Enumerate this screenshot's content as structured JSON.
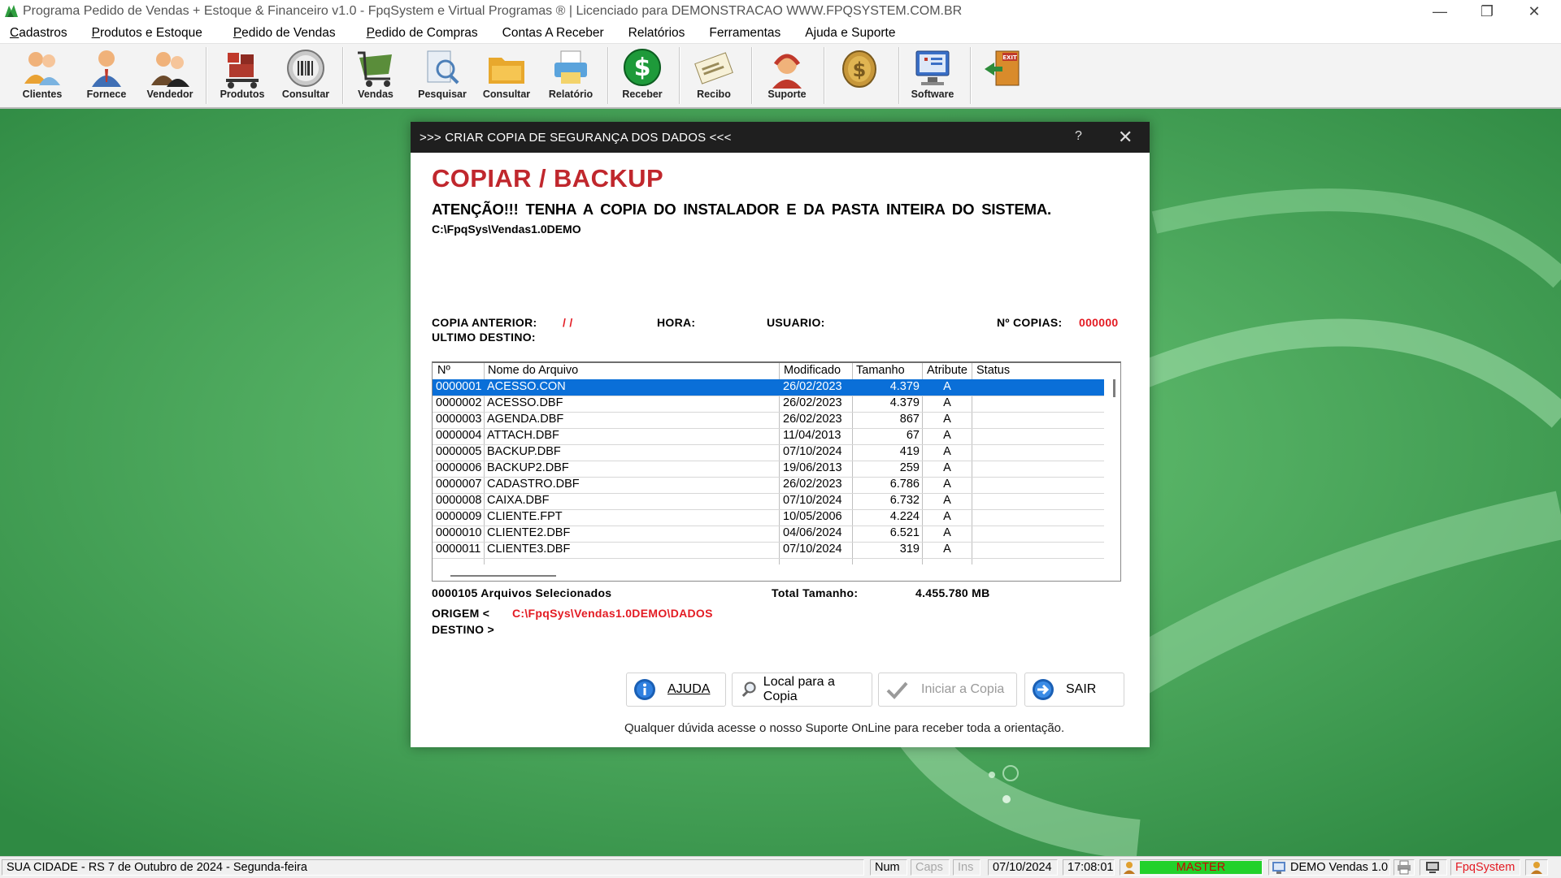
{
  "window": {
    "title": "Programa Pedido de Vendas + Estoque & Financeiro v1.0 - FpqSystem e Virtual Programas ® | Licenciado para  DEMONSTRACAO WWW.FPQSYSTEM.COM.BR"
  },
  "menu": [
    {
      "first": "C",
      "rest": "adastros"
    },
    {
      "first": "P",
      "rest": "rodutos e Estoque"
    },
    {
      "first": "P",
      "rest": "edido de Vendas"
    },
    {
      "first": "P",
      "rest": "edido de Compras"
    },
    {
      "first": "",
      "rest": "Contas A Receber"
    },
    {
      "first": "",
      "rest": "Relatórios"
    },
    {
      "first": "",
      "rest": "Ferramentas"
    },
    {
      "first": "",
      "rest": "Ajuda e Suporte"
    }
  ],
  "toolbar": [
    {
      "label": "Clientes",
      "icon": "clients-icon"
    },
    {
      "label": "Fornece",
      "icon": "supplier-icon"
    },
    {
      "label": "Vendedor",
      "icon": "seller-icon"
    },
    {
      "label": "Produtos",
      "icon": "products-icon"
    },
    {
      "label": "Consultar",
      "icon": "barcode-icon"
    },
    {
      "label": "Vendas",
      "icon": "cart-icon"
    },
    {
      "label": "Pesquisar",
      "icon": "search-doc-icon"
    },
    {
      "label": "Consultar",
      "icon": "folder-icon"
    },
    {
      "label": "Relatório",
      "icon": "printer-icon"
    },
    {
      "label": "Receber",
      "icon": "dollar-icon"
    },
    {
      "label": "Recibo",
      "icon": "receipt-icon"
    },
    {
      "label": "Suporte",
      "icon": "support-icon"
    },
    {
      "label": "",
      "icon": "coin-icon"
    },
    {
      "label": "Software",
      "icon": "software-icon"
    },
    {
      "label": "",
      "icon": "exit-icon"
    }
  ],
  "dialog": {
    "title": ">>> CRIAR COPIA DE SEGURANÇA DOS DADOS <<<",
    "help": "?",
    "heading": "COPIAR / BACKUP",
    "warning": "ATENÇÃO!!!  TENHA A COPIA DO INSTALADOR E DA PASTA INTEIRA DO SISTEMA.",
    "system_path": "C:\\FpqSys\\Vendas1.0DEMO",
    "copia_anterior_label": "COPIA ANTERIOR:",
    "copia_anterior_value": "/  /",
    "hora_label": "HORA:",
    "usuario_label": "USUARIO:",
    "ncopias_label": "Nº COPIAS:",
    "ncopias_value": "000000",
    "ultimo_destino_label": "ULTIMO DESTINO:",
    "grid": {
      "headers": [
        "Nº",
        "Nome do Arquivo",
        "Modificado",
        "Tamanho",
        "Atribute",
        "Status"
      ],
      "rows": [
        [
          "0000001",
          "ACESSO.CON",
          "26/02/2023",
          "4.379",
          "A",
          ""
        ],
        [
          "0000002",
          "ACESSO.DBF",
          "26/02/2023",
          "4.379",
          "A",
          ""
        ],
        [
          "0000003",
          "AGENDA.DBF",
          "26/02/2023",
          "867",
          "A",
          ""
        ],
        [
          "0000004",
          "ATTACH.DBF",
          "11/04/2013",
          "67",
          "A",
          ""
        ],
        [
          "0000005",
          "BACKUP.DBF",
          "07/10/2024",
          "419",
          "A",
          ""
        ],
        [
          "0000006",
          "BACKUP2.DBF",
          "19/06/2013",
          "259",
          "A",
          ""
        ],
        [
          "0000007",
          "CADASTRO.DBF",
          "26/02/2023",
          "6.786",
          "A",
          ""
        ],
        [
          "0000008",
          "CAIXA.DBF",
          "07/10/2024",
          "6.732",
          "A",
          ""
        ],
        [
          "0000009",
          "CLIENTE.FPT",
          "10/05/2006",
          "4.224",
          "A",
          ""
        ],
        [
          "0000010",
          "CLIENTE2.DBF",
          "04/06/2024",
          "6.521",
          "A",
          ""
        ],
        [
          "0000011",
          "CLIENTE3.DBF",
          "07/10/2024",
          "319",
          "A",
          ""
        ]
      ]
    },
    "selected_files": "0000105 Arquivos  Selecionados",
    "total_label": "Total Tamanho:",
    "total_value": "4.455.780 MB",
    "origem_label": "ORIGEM  <",
    "origem_value": "C:\\FpqSys\\Vendas1.0DEMO\\DADOS",
    "destino_label": "DESTINO >",
    "buttons": {
      "ajuda": "AJUDA",
      "local": "Local para a Copia",
      "iniciar": "Iniciar a Copia",
      "sair": "SAIR"
    },
    "footnote": "Qualquer dúvida acesse o nosso Suporte OnLine para receber toda a orientação."
  },
  "status": {
    "city": "SUA CIDADE - RS  7 de Outubro de 2024 - Segunda-feira",
    "num": "Num",
    "caps": "Caps",
    "ins": "Ins",
    "date": "07/10/2024",
    "time": "17:08:01",
    "user": "MASTER",
    "product": "DEMO Vendas 1.0",
    "brand": "FpqSystem"
  },
  "colors": {
    "accent_red": "#c0272d",
    "selection_blue": "#0a6fd8",
    "background_green": "#3b9a4e",
    "status_green": "#22d12b"
  }
}
